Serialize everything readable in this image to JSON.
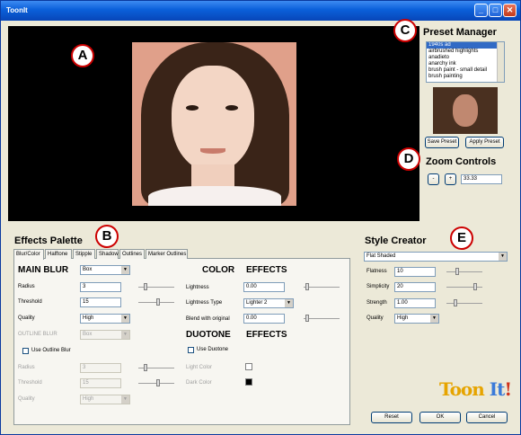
{
  "window": {
    "title": "ToonIt",
    "minimize": "_",
    "maximize": "□",
    "close": "✕"
  },
  "callouts": {
    "a": "A",
    "b": "B",
    "c": "C",
    "d": "D",
    "e": "E"
  },
  "preset_manager": {
    "title": "Preset Manager",
    "items": [
      "1940s ad",
      "airbrushed highlights",
      "anadieto",
      "anarchy ink",
      "brush paint - small detail",
      "brush painting"
    ],
    "save_label": "Save Preset",
    "apply_label": "Apply Preset"
  },
  "zoom": {
    "title": "Zoom Controls",
    "minus": "-",
    "plus": "+",
    "value": "33.33"
  },
  "effects_palette": {
    "title": "Effects Palette",
    "tabs": [
      "Blur/Color",
      "Halftone",
      "Stipple",
      "Shadow",
      "Outlines",
      "Marker Outlines"
    ],
    "main_blur": "MAIN BLUR",
    "main_blur_type": "Box",
    "radius_label": "Radius",
    "radius_value": "3",
    "threshold_label": "Threshold",
    "threshold_value": "15",
    "quality_label": "Quality",
    "quality_value": "High",
    "outline_blur_label": "OUTLINE BLUR",
    "outline_blur_value": "Box",
    "use_outline_blur": "Use Outline Blur",
    "o_radius_label": "Radius",
    "o_radius_value": "3",
    "o_threshold_label": "Threshold",
    "o_threshold_value": "15",
    "o_quality_label": "Quality",
    "o_quality_value": "High",
    "color": "COLOR",
    "color_effects": "EFFECTS",
    "lightness_label": "Lightness",
    "lightness_value": "0.00",
    "lightness_type_label": "Lightness Type",
    "lightness_type_value": "Lighter 2",
    "blend_label": "Blend with original",
    "blend_value": "0.00",
    "duotone": "DUOTONE",
    "duotone_effects": "EFFECTS",
    "use_duotone": "Use Duotone",
    "light_color_label": "Light Color",
    "dark_color_label": "Dark Color"
  },
  "style_creator": {
    "title": "Style Creator",
    "style_value": "Flat Shaded",
    "flatness_label": "Flatness",
    "flatness_value": "10",
    "simplicity_label": "Simplicity",
    "simplicity_value": "20",
    "strength_label": "Strength",
    "strength_value": "1.00",
    "quality_label": "Quality",
    "quality_value": "High"
  },
  "logo": {
    "text": "Toon It!"
  },
  "footer": {
    "reset": "Reset",
    "ok": "OK",
    "cancel": "Cancel"
  },
  "colors": {
    "light_color": "#ffffff",
    "dark_color": "#000000",
    "callout_ring": "#cc0000"
  }
}
